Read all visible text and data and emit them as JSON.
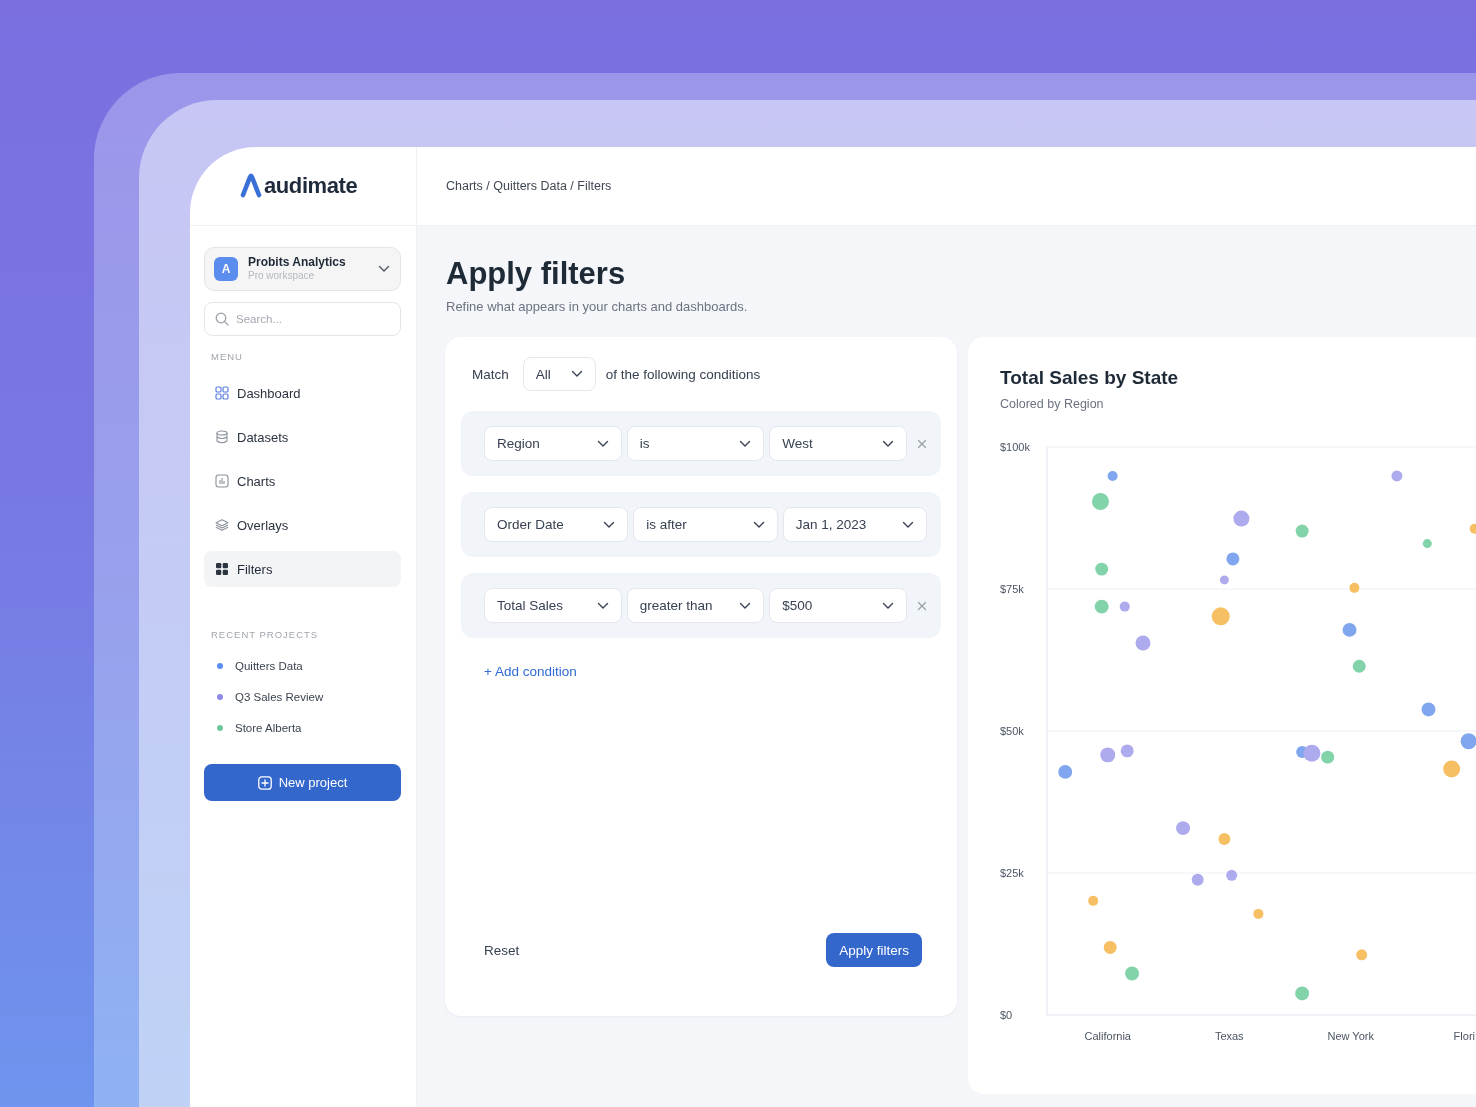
{
  "sidebar": {
    "logo": {
      "text": "audimate"
    },
    "workspace": {
      "initial": "A",
      "name": "Probits Analytics",
      "plan": "Pro workspace"
    },
    "search": {
      "placeholder": "Search..."
    },
    "menu_heading": "MENU",
    "menu": [
      {
        "label": "Dashboard",
        "selected": false
      },
      {
        "label": "Datasets",
        "selected": false
      },
      {
        "label": "Charts",
        "selected": false
      },
      {
        "label": "Overlays",
        "selected": false
      },
      {
        "label": "Filters",
        "selected": true
      }
    ],
    "recent_heading": "RECENT PROJECTS",
    "recent_projects": [
      {
        "name": "Quitters Data",
        "color": "#5b8def"
      },
      {
        "name": "Q3 Sales Review",
        "color": "#8d89e6"
      },
      {
        "name": "Store Alberta",
        "color": "#6cc79a"
      }
    ],
    "new_project_button": "New project"
  },
  "header": {
    "breadcrumb": "Charts / Quitters Data / Filters"
  },
  "page": {
    "title": "Apply filters",
    "subtitle": "Refine what appears in your charts and dashboards."
  },
  "filters": {
    "match_label": "Match",
    "match_value": "All",
    "match_suffix": "of the following conditions",
    "conditions": [
      {
        "field": "Region",
        "operator": "is",
        "value": "West",
        "removable": true
      },
      {
        "field": "Order Date",
        "operator": "is after",
        "value": "Jan 1, 2023",
        "removable": false
      },
      {
        "field": "Total Sales",
        "operator": "greater than",
        "value": "$500",
        "removable": true
      }
    ],
    "add_condition": "+ Add condition",
    "reset_button": "Reset",
    "apply_button": "Apply filters"
  },
  "chart_panel": {
    "title": "Total Sales by State",
    "subtitle": "Colored by Region",
    "chart_data": {
      "type": "scatter",
      "categories": [
        "California",
        "Texas",
        "New York",
        "Flori"
      ],
      "ylim": [
        0,
        100000
      ],
      "grid": true,
      "yticks": [
        {
          "value": 0,
          "label": "$0"
        },
        {
          "value": 25000,
          "label": "$25k"
        },
        {
          "value": 50000,
          "label": "$50k"
        },
        {
          "value": 75000,
          "label": "$75k"
        },
        {
          "value": 100000,
          "label": "$100k"
        }
      ],
      "series": [
        {
          "color": "#7fa6ee",
          "values": [
            94900,
            80300,
            67800,
            53800
          ],
          "sizes": [
            0.31,
            0.52,
            0.6,
            0.6
          ]
        },
        {
          "color": "#7fa6ee",
          "values": [
            42800,
            null,
            46300,
            48200
          ],
          "sizes": [
            0.6,
            null,
            0.44,
            0.79
          ]
        },
        {
          "color": "#aeaaee",
          "values": [
            71900,
            87400,
            94900,
            null
          ],
          "sizes": [
            0.31,
            0.79,
            0.37,
            null
          ]
        },
        {
          "color": "#aeaaee",
          "values": [
            65500,
            76600,
            46100,
            null
          ],
          "sizes": [
            0.69,
            0.25,
            0.89,
            null
          ]
        },
        {
          "color": "#aeaaee",
          "values": [
            46500,
            32900,
            null,
            null
          ],
          "sizes": [
            0.52,
            0.6,
            null,
            null
          ]
        },
        {
          "color": "#aeaaee",
          "values": [
            45800,
            24600,
            null,
            null
          ],
          "sizes": [
            0.69,
            0.37,
            null,
            null
          ]
        },
        {
          "color": "#aeaaee",
          "values": [
            null,
            23800,
            null,
            null
          ],
          "sizes": [
            null,
            0.44,
            null,
            null
          ]
        },
        {
          "color": "#82d2aa",
          "values": [
            90400,
            null,
            85200,
            83000
          ],
          "sizes": [
            0.89,
            null,
            0.52,
            0.25
          ]
        },
        {
          "color": "#82d2aa",
          "values": [
            78500,
            null,
            61400,
            null
          ],
          "sizes": [
            0.52,
            null,
            0.52,
            null
          ]
        },
        {
          "color": "#82d2aa",
          "values": [
            71900,
            null,
            45400,
            null
          ],
          "sizes": [
            0.6,
            null,
            0.52,
            null
          ]
        },
        {
          "color": "#82d2aa",
          "values": [
            7300,
            null,
            3800,
            null
          ],
          "sizes": [
            0.6,
            null,
            0.6,
            null
          ]
        },
        {
          "color": "#f7bf63",
          "values": [
            20100,
            70200,
            75200,
            85600
          ],
          "sizes": [
            0.31,
            1.0,
            0.31,
            0.31
          ]
        },
        {
          "color": "#f7bf63",
          "values": [
            11900,
            31000,
            10600,
            43300
          ],
          "sizes": [
            0.52,
            0.44,
            0.37,
            0.89
          ]
        },
        {
          "color": "#f7bf63",
          "values": [
            null,
            17800,
            null,
            null
          ],
          "sizes": [
            null,
            0.31,
            null,
            null
          ]
        }
      ]
    }
  }
}
